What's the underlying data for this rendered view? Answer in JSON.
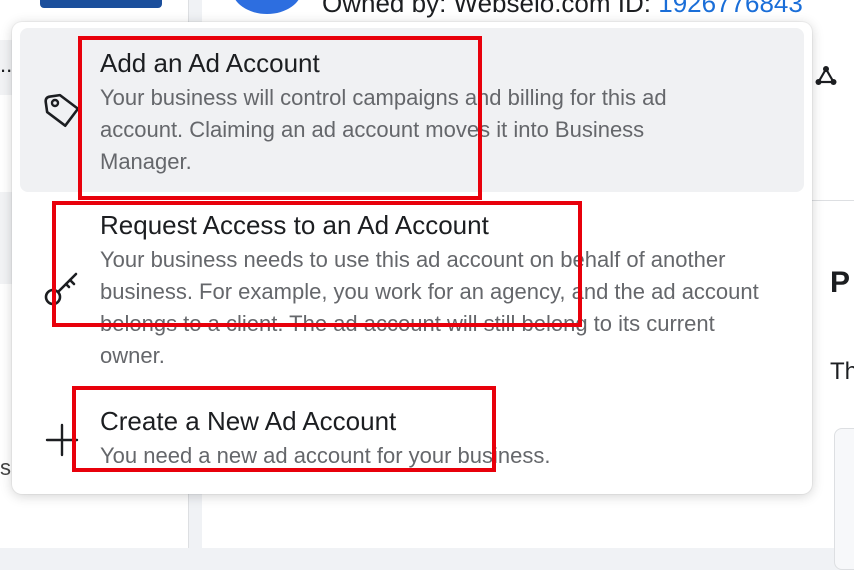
{
  "background": {
    "left_ellipsis": "..",
    "left_s": "s",
    "owned_label": "Owned by: Webselo.com",
    "id_label": "ID:",
    "id_value": "1926776843",
    "right_heading_fragment": "P",
    "right_text_fragment": "Th"
  },
  "menu": {
    "items": [
      {
        "title": "Add an Ad Account",
        "description": "Your business will control campaigns and billing for this ad account. Claiming an ad account moves it into Business Manager.",
        "icon": "tag-icon",
        "highlighted": true
      },
      {
        "title": "Request Access to an Ad Account",
        "description": "Your business needs to use this ad account on behalf of another business. For example, you work for an agency, and the ad account belongs to a client. The ad account will still belong to its current owner.",
        "icon": "key-icon",
        "highlighted": false
      },
      {
        "title": "Create a New Ad Account",
        "description": "You need a new ad account for your business.",
        "icon": "plus-icon",
        "highlighted": false
      }
    ]
  },
  "colors": {
    "annotation_red": "#e8000b",
    "link_blue": "#1a6ed8",
    "hover_gray": "#f0f1f3",
    "secondary_text": "#65676b"
  }
}
